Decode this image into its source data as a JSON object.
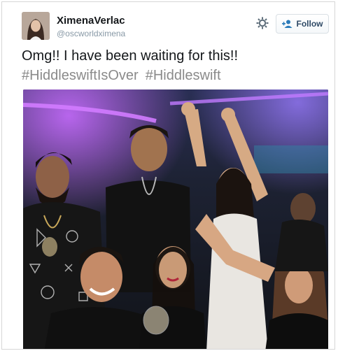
{
  "tweet": {
    "author": {
      "display_name": "XimenaVerlac",
      "handle": "@oscworldximena"
    },
    "follow_button": {
      "label": "Follow",
      "icon": "add-user-icon"
    },
    "settings_icon": "gear-icon",
    "text": "Omg!!  I have been waiting for this!!",
    "hashtags": [
      "#HiddleswiftIsOver",
      "#Hiddleswift"
    ]
  },
  "colors": {
    "name_text": "#14171a",
    "handle_text": "#8899a6",
    "hashtag_text": "#8a8a8a",
    "follow_button_text": "#2f4a66",
    "follow_button_border": "#d9dfe4"
  }
}
